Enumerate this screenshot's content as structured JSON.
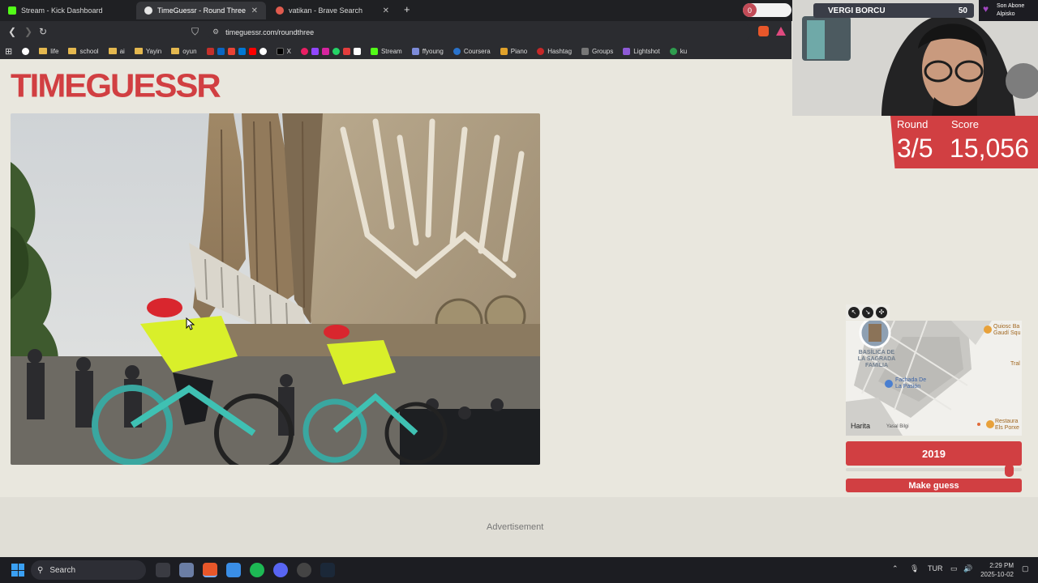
{
  "browser": {
    "tabs": [
      {
        "title": "Stream - Kick Dashboard",
        "favicon_color": "#53fc18"
      },
      {
        "title": "TimeGuessr - Round Three",
        "favicon_color": "#e5e5e5"
      },
      {
        "title": "vatikan - Brave Search",
        "favicon_color": "#e05b4e"
      }
    ],
    "notification_count": "0",
    "url": "timeguessr.com/roundthree",
    "bookmarks": [
      {
        "label": "life",
        "type": "folder"
      },
      {
        "label": "school",
        "type": "folder"
      },
      {
        "label": "ai",
        "type": "folder"
      },
      {
        "label": "Yayin",
        "type": "folder"
      },
      {
        "label": "oyun",
        "type": "folder"
      },
      {
        "label": "X",
        "type": "x"
      },
      {
        "label": "Stream",
        "type": "kick"
      },
      {
        "label": "ffyoung",
        "type": "link"
      },
      {
        "label": "Coursera",
        "type": "link"
      },
      {
        "label": "Piano",
        "type": "link"
      },
      {
        "label": "Hashtag",
        "type": "link"
      },
      {
        "label": "Groups",
        "type": "link"
      },
      {
        "label": "Lightshot",
        "type": "link"
      },
      {
        "label": "ku",
        "type": "link"
      }
    ]
  },
  "stream_overlay": {
    "label": "VERGI BORCU",
    "value": "50",
    "sub_line1": "Son Abone",
    "sub_line2": "Alpisko"
  },
  "game": {
    "logo": "TIMEGUESSR",
    "round_label": "Round",
    "round_value": "3/5",
    "score_label": "Score",
    "score_value": "15,056",
    "map_labels": {
      "basilica": "BASÍLICA DE LA SAGRADA FAMÍLIA",
      "fachada": "Fachada De La Pasión",
      "quiosc": "Quiosc Ba Gaudí Squ",
      "restaura": "Restaura Els Porxe",
      "tra": "Tral",
      "harita": "Harita",
      "yasal": "Yasal Bilgi"
    },
    "year": "2019",
    "year_slider_fraction": 0.92,
    "make_guess": "Make guess"
  },
  "ad_label": "Advertisement",
  "taskbar": {
    "search_placeholder": "Search",
    "lang": "TUR",
    "time": "2:29 PM",
    "date": "2025-10-02"
  },
  "colors": {
    "accent": "#d13f42",
    "page_bg": "#e9e7de"
  }
}
